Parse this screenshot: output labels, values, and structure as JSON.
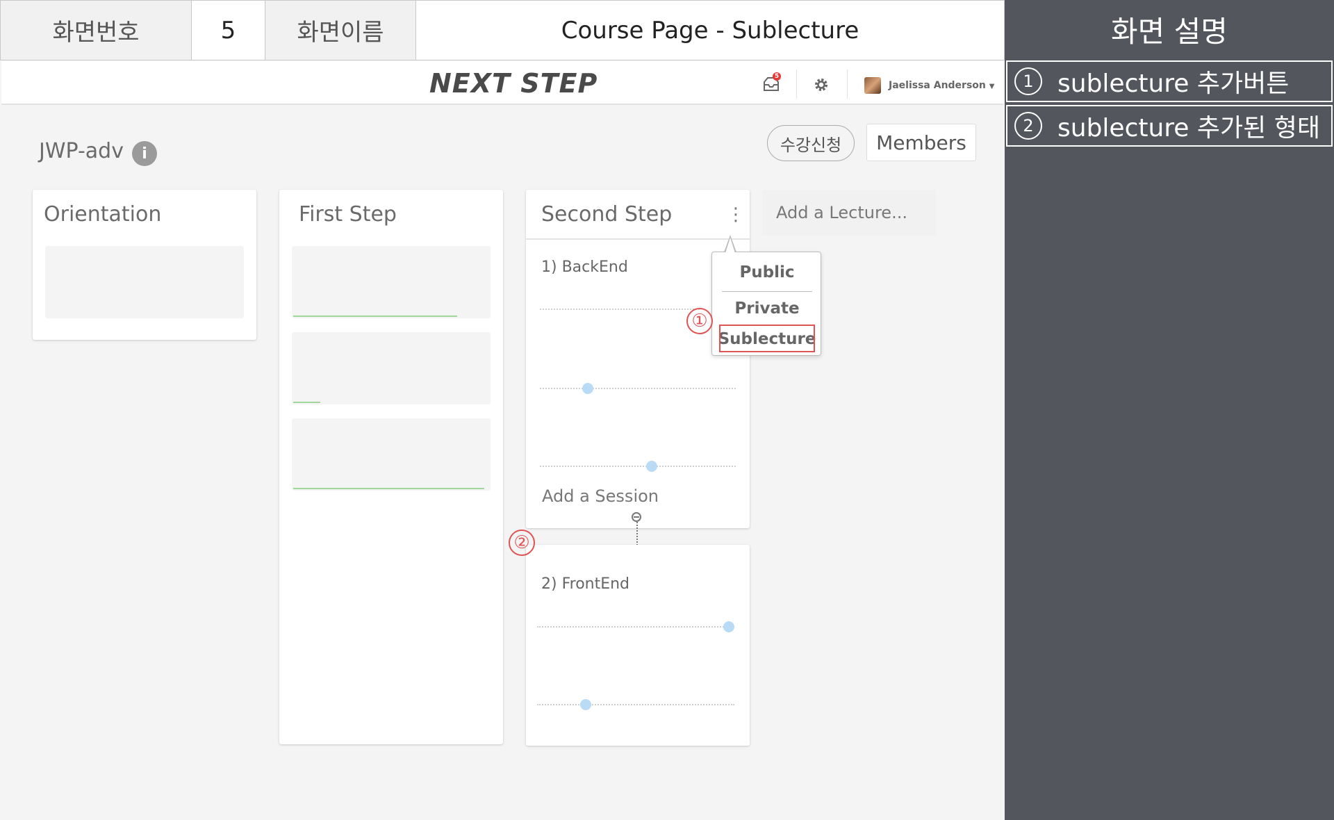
{
  "spec": {
    "screen_no_label": "화면번호",
    "screen_no": "5",
    "screen_name_label": "화면이름",
    "screen_name": "Course Page - Sublecture"
  },
  "description": {
    "title": "화면 설명",
    "items": [
      {
        "num": "1",
        "text": "sublecture 추가버튼"
      },
      {
        "num": "2",
        "text": "sublecture 추가된 형태"
      }
    ]
  },
  "navbar": {
    "brand": "NEXT STEP",
    "notification_count": "5",
    "user_name": "Jaelissa Anderson",
    "bell_icon": "inbox-icon",
    "settings_icon": "gear-icon"
  },
  "course": {
    "title": "JWP-adv",
    "enroll_label": "수강신청",
    "members_label": "Members"
  },
  "columns": [
    {
      "title": "Orientation"
    },
    {
      "title": "First Step"
    },
    {
      "title": "Second Step"
    }
  ],
  "first_step_progress": [
    0.85,
    0.14,
    0.99
  ],
  "sublectures": [
    {
      "title": "1) BackEnd"
    },
    {
      "title": "2) FrontEnd"
    }
  ],
  "add_session_label": "Add a Session",
  "add_lecture_label": "Add a Lecture...",
  "dropdown": {
    "items": [
      "Public",
      "Private",
      "Sublecture"
    ]
  },
  "markers": [
    "①",
    "②"
  ],
  "colors": {
    "accent_red": "#e05353",
    "panel_bg": "#53565c",
    "dot_blue": "#b9dbf6",
    "progress_green": "#9fd89a"
  }
}
